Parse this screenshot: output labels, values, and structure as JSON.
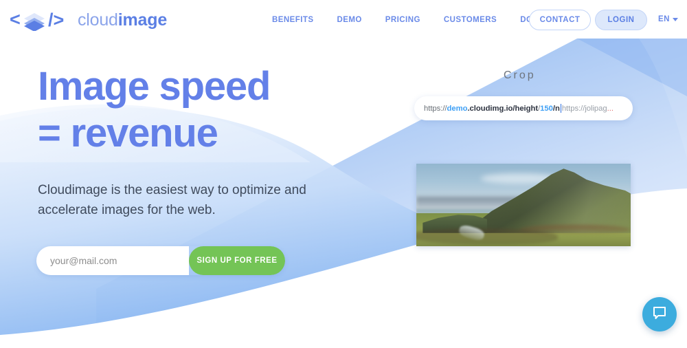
{
  "brand": {
    "logo_icon": "code-layers-icon",
    "logo_prefix": "</",
    "logo_suffix": "/>",
    "name_light": "cloud",
    "name_bold": "image",
    "accent_blue": "#6380e8",
    "accent_green": "#74c456",
    "chat_blue": "#3cacde"
  },
  "header": {
    "nav": [
      {
        "label": "BENEFITS",
        "name": "nav-benefits"
      },
      {
        "label": "DEMO",
        "name": "nav-demo"
      },
      {
        "label": "PRICING",
        "name": "nav-pricing"
      },
      {
        "label": "CUSTOMERS",
        "name": "nav-customers"
      },
      {
        "label": "DOCS",
        "name": "nav-docs"
      }
    ],
    "contact_label": "CONTACT",
    "login_label": "LOGIN",
    "lang_label": "EN"
  },
  "hero": {
    "headline_line1": "Image speed",
    "headline_line2": "= revenue",
    "subheadline": "Cloudimage is the easiest way to optimize and accelerate images for the web.",
    "email_placeholder": "your@mail.com",
    "email_value": "",
    "signup_label": "SIGN UP FOR FREE"
  },
  "demo": {
    "crop_label": "Crop",
    "url": {
      "protocol": "https://",
      "subdomain": "demo",
      "domain": ".cloudimg.io/",
      "param_key": "height",
      "slash1": "/",
      "param_value": "150",
      "param_suffix": "/n",
      "source": "https://jolipag",
      "ellipsis": "..."
    },
    "image_alt": "mountain-landscape-photo"
  },
  "widgets": {
    "chat_icon": "speech-bubble-icon"
  }
}
